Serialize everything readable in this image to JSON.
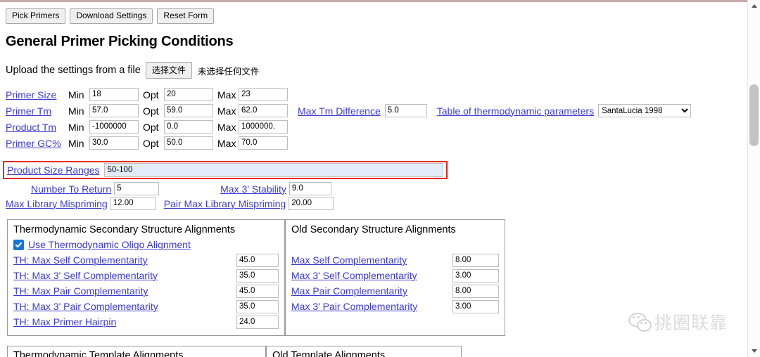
{
  "toolbar": {
    "buttons": [
      {
        "label": "Pick Primers"
      },
      {
        "label": "Download Settings"
      },
      {
        "label": "Reset Form"
      }
    ]
  },
  "heading": "General Primer Picking Conditions",
  "upload": {
    "label": "Upload the settings from a file",
    "button_label": "选择文件",
    "status": "未选择任何文件"
  },
  "labels": {
    "min": "Min",
    "opt": "Opt",
    "max": "Max"
  },
  "params": {
    "rows": [
      {
        "name": "Primer Size",
        "min": "18",
        "opt": "20",
        "max": "23"
      },
      {
        "name": "Primer Tm",
        "min": "57.0",
        "opt": "59.0",
        "max": "62.0"
      },
      {
        "name": "Product Tm",
        "min": "-1000000",
        "opt": "0.0",
        "max": "1000000."
      },
      {
        "name": "Primer GC%",
        "min": "30.0",
        "opt": "50.0",
        "max": "70.0"
      }
    ],
    "max_tm_difference_label": "Max Tm Difference",
    "max_tm_difference_value": "5.0",
    "thermo_table_label": "Table of thermodynamic parameters",
    "thermo_table_value": "SantaLucia 1998",
    "thermo_table_options": [
      "SantaLucia 1998"
    ]
  },
  "product_size_ranges": {
    "label": "Product Size Ranges",
    "value": "50-100",
    "highlight_color": "#e8291c",
    "field_background": "#e3ecfb"
  },
  "misc": {
    "number_to_return_label": "Number To Return",
    "number_to_return_value": "5",
    "max_3_stability_label": "Max 3' Stability",
    "max_3_stability_value": "9.0",
    "max_library_mispriming_label": "Max Library Mispriming",
    "max_library_mispriming_value": "12.00",
    "pair_max_library_mispriming_label": "Pair Max Library Mispriming",
    "pair_max_library_mispriming_value": "20.00"
  },
  "thermo_panel": {
    "title": "Thermodynamic Secondary Structure Alignments",
    "checkbox_label": "Use Thermodynamic Oligo Alignment",
    "checkbox_checked": true,
    "rows": [
      {
        "label": "TH: Max Self Complementarity",
        "value": "45.0"
      },
      {
        "label": "TH: Max 3' Self Complementarity",
        "value": "35.0"
      },
      {
        "label": "TH: Max Pair Complementarity",
        "value": "45.0"
      },
      {
        "label": "TH: Max 3' Pair Complementarity",
        "value": "35.0"
      },
      {
        "label": "TH: Max Primer Hairpin",
        "value": "24.0"
      }
    ]
  },
  "old_panel": {
    "title": "Old Secondary Structure Alignments",
    "rows": [
      {
        "label": "Max Self Complementarity",
        "value": "8.00"
      },
      {
        "label": "Max 3' Self Complementarity",
        "value": "3.00"
      },
      {
        "label": "Max Pair Complementarity",
        "value": "8.00"
      },
      {
        "label": "Max 3' Pair Complementarity",
        "value": "3.00"
      }
    ]
  },
  "bottom_panels": [
    {
      "title": "Thermodynamic Template Alignments"
    },
    {
      "title": "Old Template Alignments"
    }
  ],
  "watermark": {
    "text": "挑圈联靠"
  }
}
